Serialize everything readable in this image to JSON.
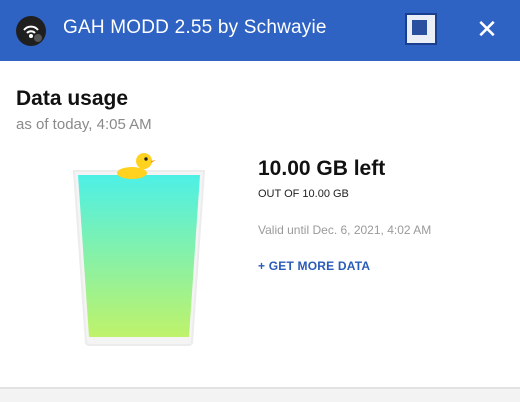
{
  "window": {
    "title": "GAH MODD 2.55 by Schwayie",
    "restore_icon": "restore-window-icon",
    "close_symbol": "✕"
  },
  "card": {
    "title": "Data usage",
    "subtitle": "as of today, 4:05 AM",
    "remaining": "10.00 GB left",
    "total": "OUT OF 10.00 GB",
    "valid_until": "Valid until Dec. 6, 2021, 4:02 AM",
    "cta": "+ GET MORE DATA",
    "fill_fraction": 1.0
  },
  "colors": {
    "titlebar": "#2e62c3",
    "accent": "#2a5bb8",
    "liquid_top": "#4df0e6",
    "liquid_bottom": "#bff26a",
    "duck": "#ffd21f"
  }
}
